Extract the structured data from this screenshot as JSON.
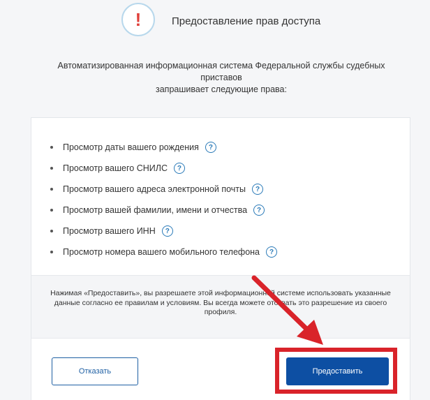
{
  "header": {
    "alert_glyph": "!",
    "title": "Предоставление прав доступа"
  },
  "intro": {
    "line1": "Автоматизированная информационная система Федеральной службы судебных приставов",
    "line2": "запрашивает следующие права:"
  },
  "permissions": [
    {
      "label": "Просмотр даты вашего рождения",
      "help": "?"
    },
    {
      "label": "Просмотр вашего СНИЛС",
      "help": "?"
    },
    {
      "label": "Просмотр вашего адреса электронной почты",
      "help": "?"
    },
    {
      "label": "Просмотр вашей фамилии, имени и отчества",
      "help": "?"
    },
    {
      "label": "Просмотр вашего ИНН",
      "help": "?"
    },
    {
      "label": "Просмотр номера вашего мобильного телефона",
      "help": "?"
    }
  ],
  "notice": {
    "text": "Нажимая «Предоставить», вы разрешаете этой информационной системе использовать указанные данные согласно ее правилам и условиям. Вы всегда можете отозвать это разрешение из своего профиля."
  },
  "buttons": {
    "cancel_label": "Отказать",
    "grant_label": "Предоставить"
  },
  "colors": {
    "primary": "#0d4fa3",
    "annotation_red": "#d9232a",
    "alert_red": "#e0403a",
    "help_blue": "#2a7ab8"
  }
}
